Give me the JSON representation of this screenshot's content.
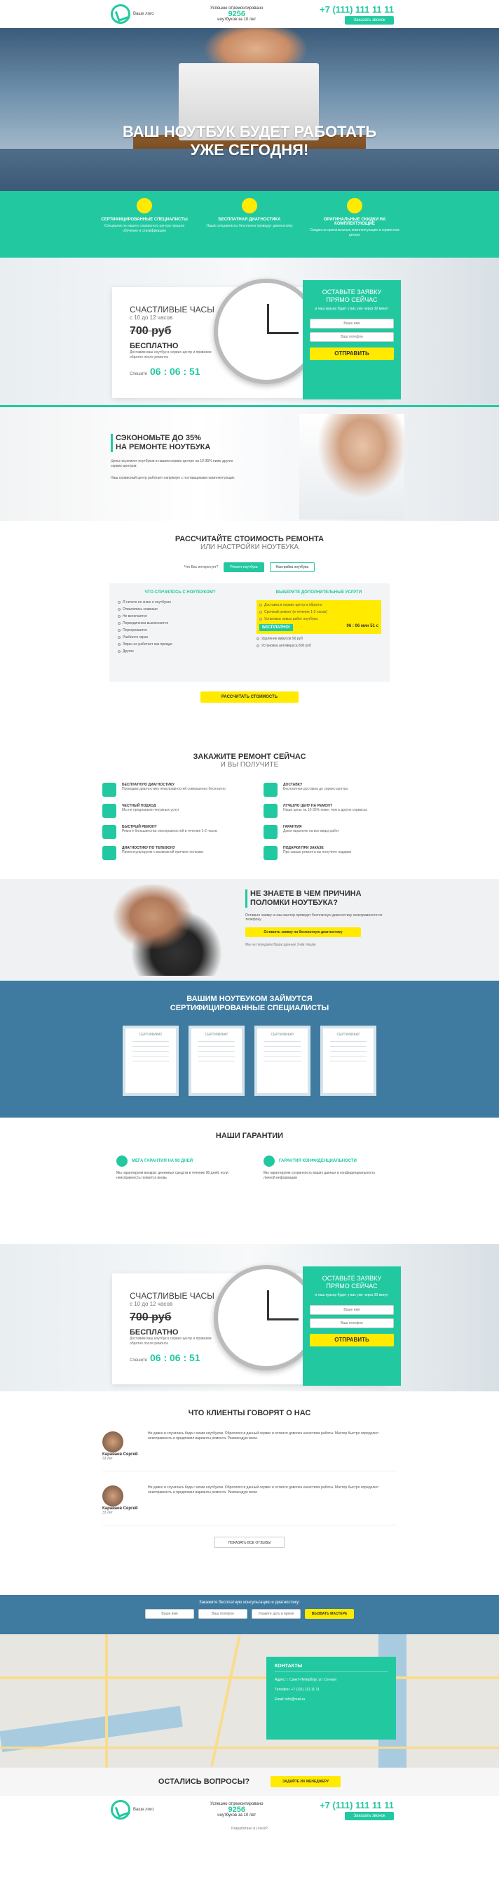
{
  "header": {
    "logo_text": "Ваше лого",
    "mid_top": "Успешно отремонтировано",
    "count": "9256",
    "mid_bottom": "ноутбуков за 10 лет",
    "phone": "+7 (111) 111 11 11",
    "callback": "Заказать звонок"
  },
  "hero": {
    "line1": "ВАШ НОУТБУК БУДЕТ РАБОТАТЬ",
    "line2": "УЖЕ СЕГОДНЯ!"
  },
  "features": [
    {
      "icon": "specialist-icon",
      "title": "СЕРТИФИЦИРОВАННЫЕ СПЕЦИАЛИСТЫ",
      "desc": "Специалисты нашего сервисного центра прошли обучение и сертификацию"
    },
    {
      "icon": "diagnostic-icon",
      "title": "БЕСПЛАТНАЯ ДИАГНОСТИКА",
      "desc": "Наши специалисты бесплатно проведут диагностику"
    },
    {
      "icon": "chip-icon",
      "title": "ОРИГИНАЛЬНЫЕ СКИДКИ НА КОМПЛЕКТУЮЩИЕ",
      "desc": "Скидки на оригинальные комплектующие в сервисном центре"
    }
  ],
  "promo": {
    "l1": "СЧАСТЛИВЫЕ ЧАСЫ",
    "l2": "с 10 до 12 часов",
    "old_price": "700 руб",
    "free": "БЕСПЛАТНО",
    "free_desc": "Доставим ваш ноутбук в сервис-центр и привезем обратно после ремонта",
    "timer_label": "Спешите",
    "timer": "06 : 06 : 51",
    "form_title": "ОСТАВЬТЕ ЗАЯВКУ ПРЯМО СЕЙЧАС",
    "form_sub": "и наш курьер будет у вас уже через 30 минут",
    "name_ph": "Ваше имя",
    "phone_ph": "Ваш телефон",
    "submit": "ОТПРАВИТЬ"
  },
  "save": {
    "t1": "СЭКОНОМЬТЕ ДО 35%",
    "t2": "НА РЕМОНТЕ НОУТБУКА",
    "p1": "Цены на ремонт ноутбуков в нашем сервис-центре на 10-35% ниже других сервис-центров",
    "p2": "Наш сервисный центр работает напрямую с поставщиками комплектующих"
  },
  "calc": {
    "title": "РАССЧИТАЙТЕ СТОИМОСТЬ РЕМОНТА",
    "subtitle": "ИЛИ НАСТРОЙКИ НОУТБУКА",
    "ask": "Что Вас интересует?",
    "tab1": "Ремонт ноутбука",
    "tab2": "Настройка ноутбука",
    "left_head": "ЧТО СЛУЧИЛОСЬ С НОУТБУКОМ?",
    "left_opts": [
      "Я ничего не знаю о ноутбуках",
      "Отвалились клавиши",
      "Не включается",
      "Периодически выключается",
      "Перегревается",
      "Разбился экран",
      "Экран не работает как прежде",
      "Другое"
    ],
    "right_head": "ВЫБЕРИТЕ ДОПОЛНИТЕЛЬНЫЕ УСЛУГИ",
    "right_opts": [
      "Доставка в сервис-центр и обратно",
      "Срочный ремонт (в течение 1-2 часов)",
      "Установка новых работ ноутбука"
    ],
    "free_label": "БЕСПЛАТНО!",
    "time_label": "06 : 06 мин 51 с",
    "extra_opts": [
      "Удаление вирусов 90 руб",
      "Установка антивируса 800 руб"
    ],
    "button": "РАССЧИТАТЬ СТОИМОСТЬ"
  },
  "order": {
    "title": "ЗАКАЖИТЕ РЕМОНТ СЕЙЧАС",
    "subtitle": "И ВЫ ПОЛУЧИТЕ",
    "items": [
      {
        "icon": "diagnostic-icon",
        "t": "БЕСПЛАТНУЮ ДИАГНОСТИКУ",
        "d": "Проводим диагностику неисправностей совершенно бесплатно"
      },
      {
        "icon": "delivery-icon",
        "t": "ДОСТАВКУ",
        "d": "Бесплатная доставка до сервис-центра"
      },
      {
        "icon": "wallet-icon",
        "t": "ЧЕСТНЫЙ ПОДХОД",
        "d": "Мы не предлагаем ненужных услуг"
      },
      {
        "icon": "price-icon",
        "t": "ЛУЧШУЮ ЦЕНУ НА РЕМОНТ",
        "d": "Наши цены на 10-35% ниже, чем в других сервисах"
      },
      {
        "icon": "clock-icon",
        "t": "БЫСТРЫЙ РЕМОНТ",
        "d": "Ремонт большинства неисправностей в течение 1-2 часов"
      },
      {
        "icon": "medal-icon",
        "t": "ГАРАНТИЯ",
        "d": "Даем гарантию на все виды работ"
      },
      {
        "icon": "phone-icon",
        "t": "ДИАГНОСТИКУ ПО ТЕЛЕФОНУ",
        "d": "Проконсультируем о возможной причине поломки"
      },
      {
        "icon": "gift-icon",
        "t": "ПОДАРКИ ПРИ ЗАКАЗЕ",
        "d": "При заказе ремонта вы получите подарки"
      }
    ]
  },
  "unknown": {
    "title1": "НЕ ЗНАЕТЕ В ЧЕМ ПРИЧИНА",
    "title2": "ПОЛОМКИ НОУТБУКА?",
    "desc": "Оставьте заявку и наш мастер проведет бесплатную диагностику неисправности по телефону",
    "button": "Оставить заявку на бесплатную диагностику",
    "sub": "Мы не передаем Ваши данные 3-им лицам"
  },
  "certs": {
    "title1": "ВАШИМ НОУТБУКОМ ЗАЙМУТСЯ",
    "title2": "СЕРТИФИЦИРОВАННЫЕ СПЕЦИАЛИСТЫ",
    "label": "СЕРТИФИКАТ"
  },
  "guar": {
    "title": "НАШИ ГАРАНТИИ",
    "items": [
      {
        "icon": "shield-icon",
        "t": "МЕГА ГАРАНТИЯ НА 90 ДНЕЙ",
        "d": "Мы гарантируем возврат денежных средств в течение 90 дней, если неисправность появится вновь"
      },
      {
        "icon": "lock-icon",
        "t": "ГАРАНТИЯ КОНФИДЕНЦИАЛЬНОСТИ",
        "d": "Мы гарантируем сохранность ваших данных и конфиденциальность личной информации"
      }
    ]
  },
  "reviews": {
    "title": "ЧТО КЛИЕНТЫ ГОВОРЯТ О НАС",
    "items": [
      {
        "name": "Караваев Сергей",
        "age": "33 лет",
        "text": "Не давно в случилась беда с моим ноутбуком. Обратился в данный сервис и остался доволен качеством работы. Мастер быстро определил неисправность и предложил варианты ремонта. Рекомендую всем."
      },
      {
        "name": "Караваев Сергей",
        "age": "33 лет",
        "text": "Не давно в случилась беда с моим ноутбуком. Обратился в данный сервис и остался доволен качеством работы. Мастер быстро определил неисправность и предложил варианты ремонта. Рекомендую всем."
      }
    ],
    "more": "ПОКАЗАТЬ ВСЕ ОТЗЫВЫ"
  },
  "cta": {
    "title": "Закажите бесплатную консультацию и диагностику:",
    "name_ph": "Ваше имя",
    "phone_ph": "Ваш телефон",
    "addr_ph": "Укажите дату и время",
    "button": "ВЫЗВАТЬ МАСТЕРА"
  },
  "contacts": {
    "title": "КОНТАКТЫ",
    "address": "Адрес: г. Санкт-Петербург, ул. Сенная",
    "phone": "Телефон: +7 (111) 111 11 11",
    "email": "Email: info@mail.ru"
  },
  "questions": {
    "title": "ОСТАЛИСЬ ВОПРОСЫ?",
    "button": "ЗАДАЙТЕ ИХ МЕНЕДЖЕРУ"
  },
  "footer": {
    "copyright": "Разработано в LineUP"
  },
  "colors": {
    "accent": "#22c9a0",
    "yellow": "#ffea00",
    "blue": "#3f7ba1"
  }
}
